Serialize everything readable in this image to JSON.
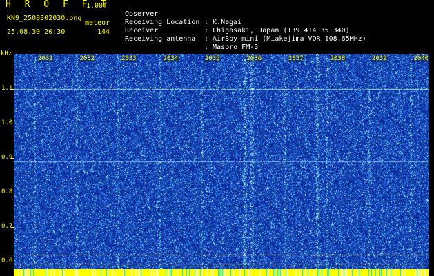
{
  "header": {
    "title": "H R O F F T",
    "version": "1.00f",
    "filename": "KN9_2508302030.png",
    "meteor_label": "meteor",
    "datetime": "25.08.30 20:30",
    "meteor_count": "144"
  },
  "info": [
    {
      "label": "Observer",
      "value": ": K.Nagai"
    },
    {
      "label": "Receiving Location",
      "value": ": Chigasaki, Japan (139.414 35.340)"
    },
    {
      "label": "Receiver",
      "value": ": AirSpy mini (Miakejima VOR 108.65MHz)"
    },
    {
      "label": "Receiving antenna",
      "value": ": Maspro FM-3"
    }
  ],
  "axis": {
    "unit": "kHz",
    "freq_labels": [
      "1.1",
      "1.0",
      "0.9",
      "0.8",
      "0.7",
      "0.6"
    ],
    "freq_values": [
      1.1,
      1.0,
      0.9,
      0.8,
      0.7,
      0.6
    ],
    "time_labels": [
      "2031",
      "2032",
      "2033",
      "2034",
      "2035",
      "2036",
      "2037",
      "2038",
      "2039",
      "2040"
    ]
  },
  "colors": {
    "background": "#000000",
    "text": "#ffff00",
    "spectrum_base": "#1a3fa8",
    "speckle": "#7fe0ff",
    "hot_line": "#b8ffd0",
    "bottom_bar": "#ffff00"
  }
}
